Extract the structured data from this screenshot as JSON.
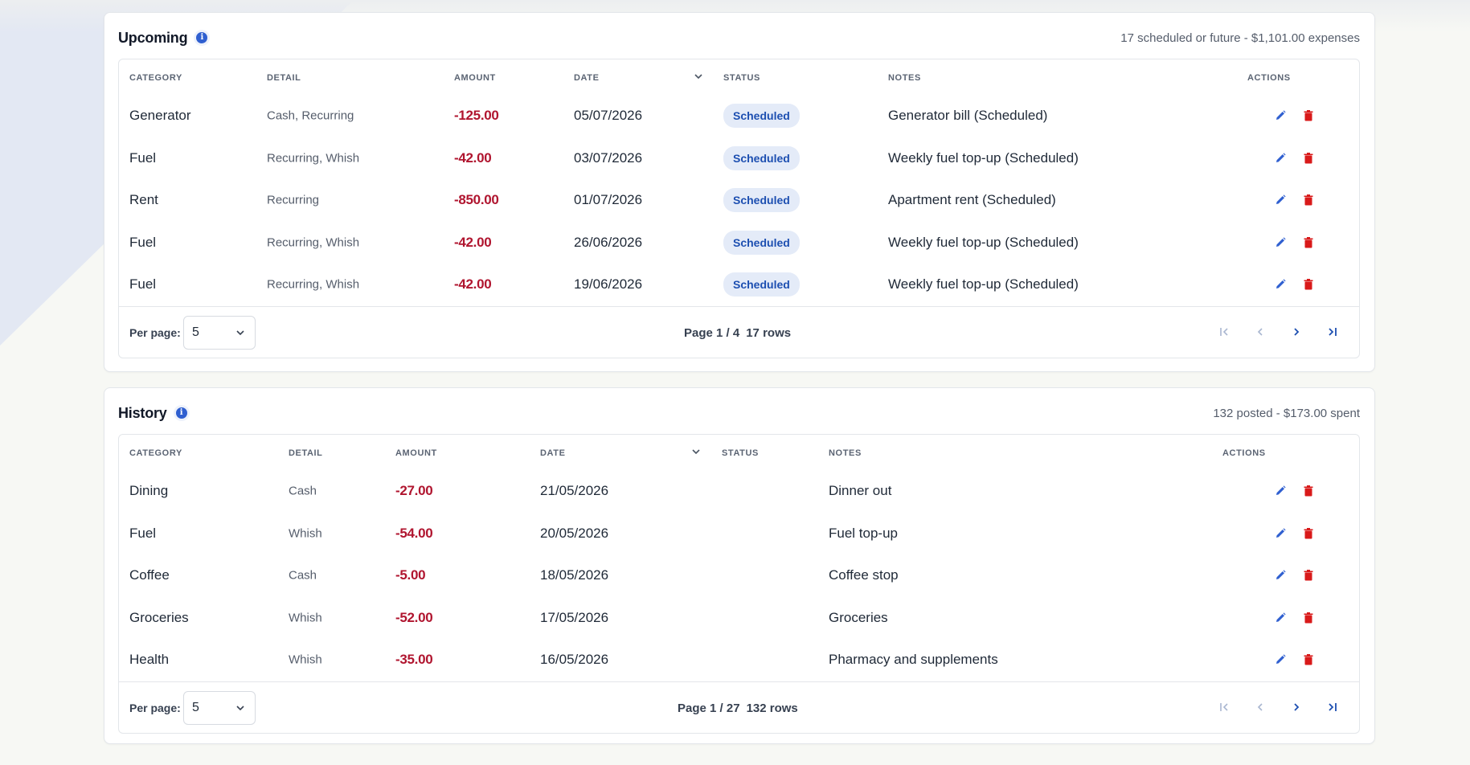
{
  "colors": {
    "accent": "#2f5fd0",
    "amount_negative": "#b0152f",
    "badge_bg": "#e4ebf8",
    "badge_text": "#1d4fb1",
    "delete_red": "#d91a1a"
  },
  "upcoming": {
    "title": "Upcoming",
    "summary": "17 scheduled or future - $1,101.00 expenses",
    "columns": {
      "category": "CATEGORY",
      "detail": "DETAIL",
      "amount": "AMOUNT",
      "date": "DATE",
      "status": "STATUS",
      "notes": "NOTES",
      "actions": "ACTIONS"
    },
    "rows": [
      {
        "category": "Generator",
        "detail": "Cash, Recurring",
        "amount": "-125.00",
        "date": "05/07/2026",
        "status": "Scheduled",
        "notes": "Generator bill (Scheduled)"
      },
      {
        "category": "Fuel",
        "detail": "Recurring, Whish",
        "amount": "-42.00",
        "date": "03/07/2026",
        "status": "Scheduled",
        "notes": "Weekly fuel top-up (Scheduled)"
      },
      {
        "category": "Rent",
        "detail": "Recurring",
        "amount": "-850.00",
        "date": "01/07/2026",
        "status": "Scheduled",
        "notes": "Apartment rent (Scheduled)"
      },
      {
        "category": "Fuel",
        "detail": "Recurring, Whish",
        "amount": "-42.00",
        "date": "26/06/2026",
        "status": "Scheduled",
        "notes": "Weekly fuel top-up (Scheduled)"
      },
      {
        "category": "Fuel",
        "detail": "Recurring, Whish",
        "amount": "-42.00",
        "date": "19/06/2026",
        "status": "Scheduled",
        "notes": "Weekly fuel top-up (Scheduled)"
      }
    ],
    "footer": {
      "per_page_label": "Per page:",
      "per_page_value": "5",
      "page_text": "Page 1 / 4",
      "rows_text": "17 rows"
    }
  },
  "history": {
    "title": "History",
    "summary": "132 posted - $173.00 spent",
    "columns": {
      "category": "CATEGORY",
      "detail": "DETAIL",
      "amount": "AMOUNT",
      "date": "DATE",
      "status": "STATUS",
      "notes": "NOTES",
      "actions": "ACTIONS"
    },
    "rows": [
      {
        "category": "Dining",
        "detail": "Cash",
        "amount": "-27.00",
        "date": "21/05/2026",
        "status": "",
        "notes": "Dinner out"
      },
      {
        "category": "Fuel",
        "detail": "Whish",
        "amount": "-54.00",
        "date": "20/05/2026",
        "status": "",
        "notes": "Fuel top-up"
      },
      {
        "category": "Coffee",
        "detail": "Cash",
        "amount": "-5.00",
        "date": "18/05/2026",
        "status": "",
        "notes": "Coffee stop"
      },
      {
        "category": "Groceries",
        "detail": "Whish",
        "amount": "-52.00",
        "date": "17/05/2026",
        "status": "",
        "notes": "Groceries"
      },
      {
        "category": "Health",
        "detail": "Whish",
        "amount": "-35.00",
        "date": "16/05/2026",
        "status": "",
        "notes": "Pharmacy and supplements"
      }
    ],
    "footer": {
      "per_page_label": "Per page:",
      "per_page_value": "5",
      "page_text": "Page 1 / 27",
      "rows_text": "132 rows"
    }
  },
  "icons": {
    "info": "info-icon",
    "sort": "chevron-down-icon",
    "edit": "pencil-icon",
    "delete": "trash-icon",
    "first": "first-page-icon",
    "prev": "chevron-left-icon",
    "next": "chevron-right-icon",
    "last": "last-page-icon"
  }
}
